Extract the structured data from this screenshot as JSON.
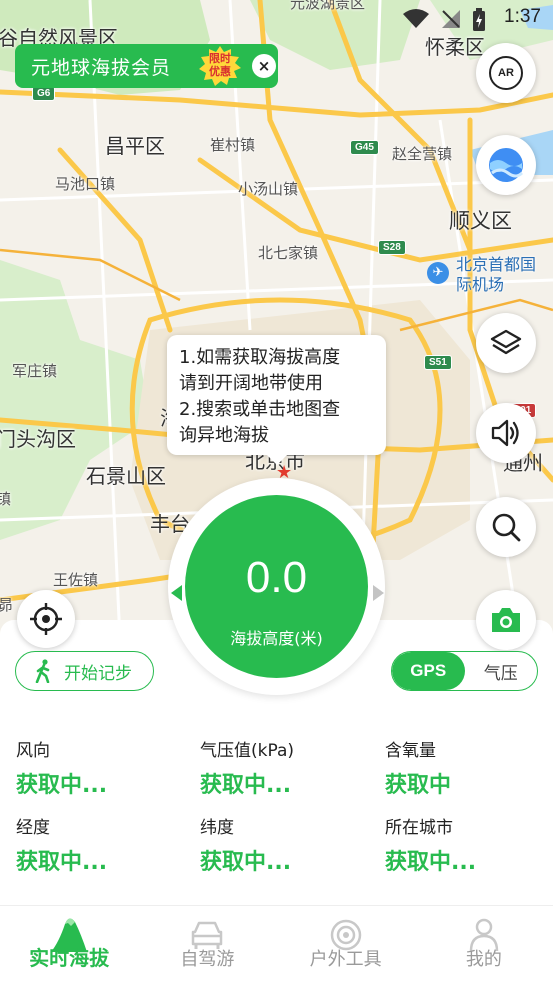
{
  "status_bar": {
    "time": "1:37"
  },
  "map": {
    "labels": {
      "nature_area": "谷自然风景区",
      "yanqi": "元波湖景区",
      "huairou": "怀柔区",
      "changping": "昌平区",
      "cuicun": "崔村镇",
      "zhaoquanying": "赵全营镇",
      "machikou": "马池口镇",
      "xiaotangshan": "小汤山镇",
      "shunyi": "顺义区",
      "beiqijia": "北七家镇",
      "airport": "北京首都国际机场",
      "junzhuang": "军庄镇",
      "mentougou": "门头沟区",
      "shijingshan": "石景山区",
      "fengtai": "丰台",
      "wangzuo": "王佐镇",
      "tongzhou": "通州",
      "zhen": "镇",
      "hai": "海",
      "beijing": "北京市",
      "yu": "昴"
    },
    "shields": [
      "G6",
      "G45",
      "S28",
      "S51",
      "S501"
    ]
  },
  "vip_banner": {
    "text": "元地球海拔会员",
    "badge": [
      "限时",
      "优惠"
    ],
    "close": "×"
  },
  "buttons": {
    "ar_label": "AR"
  },
  "tooltip": {
    "line1": "1.如需获取海拔高度",
    "line2": "请到开阔地带使用",
    "line3": "2.搜索或单击地图查",
    "line4": "询异地海拔"
  },
  "dial": {
    "value": "0.0",
    "label": "海拔高度(米)"
  },
  "walk": {
    "label": "开始记步"
  },
  "mode_toggle": {
    "gps": "GPS",
    "pressure": "气压"
  },
  "info": [
    {
      "key": "风向",
      "value": "获取中..."
    },
    {
      "key": "气压值(kPa)",
      "value": "获取中..."
    },
    {
      "key": "含氧量",
      "value": "获取中"
    },
    {
      "key": "经度",
      "value": "获取中..."
    },
    {
      "key": "纬度",
      "value": "获取中..."
    },
    {
      "key": "所在城市",
      "value": "获取中..."
    }
  ],
  "nav": [
    {
      "label": "实时海拔"
    },
    {
      "label": "自驾游"
    },
    {
      "label": "户外工具"
    },
    {
      "label": "我的"
    }
  ],
  "colors": {
    "accent": "#28bb4f",
    "road_major": "#fbc84a",
    "water": "#9fd0f5",
    "green": "#c9e9b8"
  }
}
